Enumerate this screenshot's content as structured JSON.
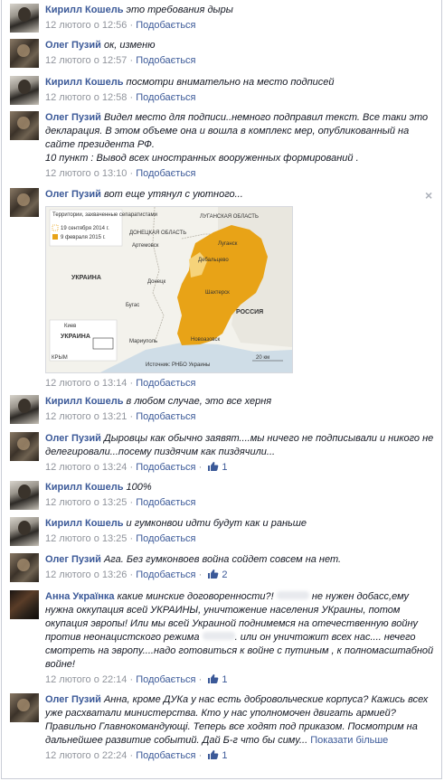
{
  "comments": [
    {
      "author": "Кирилл Кошель",
      "text": "это требования дыры",
      "time": "12 лютого о 12:56",
      "like": "Подобається"
    },
    {
      "author": "Олег Пузий",
      "text": "ок, изменю",
      "time": "12 лютого о 12:57",
      "like": "Подобається"
    },
    {
      "author": "Кирилл Кошель",
      "text": "посмотри внимательно на место подписей",
      "time": "12 лютого о 12:58",
      "like": "Подобається"
    },
    {
      "author": "Олег Пузий",
      "text": "Видел место для подписи..немного подправил текст. Все таки это декларация. В этом объеме она и вошла в комплекс мер, опубликованный на сайте президента РФ.",
      "text2": "10 пункт : Вывод всех иностранных вооруженных формирований .",
      "time": "12 лютого о 13:10",
      "like": "Подобається"
    },
    {
      "author": "Олег Пузий",
      "text": "вот еще утянул с уютного...",
      "time": "12 лютого о 13:14",
      "like": "Подобається"
    },
    {
      "author": "Кирилл Кошель",
      "text": "в любом случае, это все херня",
      "time": "12 лютого о 13:21",
      "like": "Подобається"
    },
    {
      "author": "Олег Пузий",
      "text": "Дыровцы как обычно заявят....мы ничего не подписывали и никого не делегировали...посему пиздячим как пиздячили...",
      "time": "12 лютого о 13:24",
      "like": "Подобається",
      "likes": "1"
    },
    {
      "author": "Кирилл Кошель",
      "text": "100%",
      "time": "12 лютого о 13:25",
      "like": "Подобається"
    },
    {
      "author": "Кирилл Кошель",
      "text": "и гумконвои идти будут как и раньше",
      "time": "12 лютого о 13:25",
      "like": "Подобається"
    },
    {
      "author": "Олег Пузий",
      "text": "Ага. Без гумконвоев война сойдет совсем на нет.",
      "time": "12 лютого о 13:26",
      "like": "Подобається",
      "likes": "2"
    },
    {
      "author": "Анна Украïнка",
      "text_a": "какие минские договоренности?!",
      "text_b": "не нужен добасс,ему нужна оккупация всей УКРАИНЫ, уничтожение населения УКраины, потом окупация эвропы! Или мы всей Украиной поднимемся на отечественную войну против неонацистского режима",
      "text_c": ". или он уничтожит всех нас.... нечего смотреть на эвропу....надо готовиться к войне с путиным , к полномасштабной войне!",
      "time": "12 лютого о 22:14",
      "like": "Подобається",
      "likes": "1"
    },
    {
      "author": "Олег Пузий",
      "text": "Анна, кроме ДУКа у нас есть добровольческие корпуса? Кажись всех уже расхватали министерства. Кто у нас уполномочен двигать армией? Правильно Главнокомандующі. Теперь все ходят под приказом. Посмотрим на дальнейшее развитие событий. Дай Б-г что бы симу...",
      "more": "Показати більше",
      "time": "12 лютого о 22:24",
      "like": "Подобається",
      "likes": "1"
    }
  ],
  "close_glyph": "×",
  "map": {
    "legend_title": "Территории, захваченные сепаратистами",
    "legend_1": "19 сентября 2014 г.",
    "legend_2": "9 февраля 2015 г.",
    "region_donetsk": "ДОНЕЦКАЯ ОБЛАСТЬ",
    "region_lugansk": "ЛУГАНСКАЯ ОБЛАСТЬ",
    "ukraine": "УКРАИНА",
    "russia": "РОССИЯ",
    "artemovsk": "Артемовск",
    "lugansk": "Луганск",
    "debaltsevo": "Дебальцево",
    "donetsk": "Донецк",
    "shakhtersk": "Шахтерск",
    "bugas": "Бугас",
    "mariupol": "Мариуполь",
    "novoazovsk": "Новоазовск",
    "kiev": "Киев",
    "inset_ukraine": "УКРАИНА",
    "crimea": "КРЫМ",
    "source": "Источник: РНБО Украины",
    "scale": "20 км",
    "yellow": "#e8a317",
    "light": "#f6d37a"
  }
}
